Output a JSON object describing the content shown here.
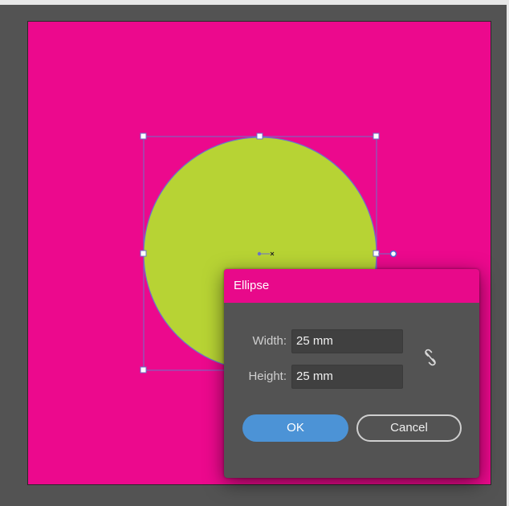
{
  "colors": {
    "artboard_fill": "#ec098d",
    "ellipse_fill": "#b7d334",
    "selection_color": "#6b74c8",
    "dialog_title_bg": "#e8098a",
    "ok_button": "#4c93d6",
    "workspace": "#535353"
  },
  "dialog": {
    "title": "Ellipse",
    "width_label": "Width:",
    "width_value": "25 mm",
    "height_label": "Height:",
    "height_value": "25 mm",
    "constrain_icon": "unlink-proportions-icon",
    "ok_label": "OK",
    "cancel_label": "Cancel"
  }
}
